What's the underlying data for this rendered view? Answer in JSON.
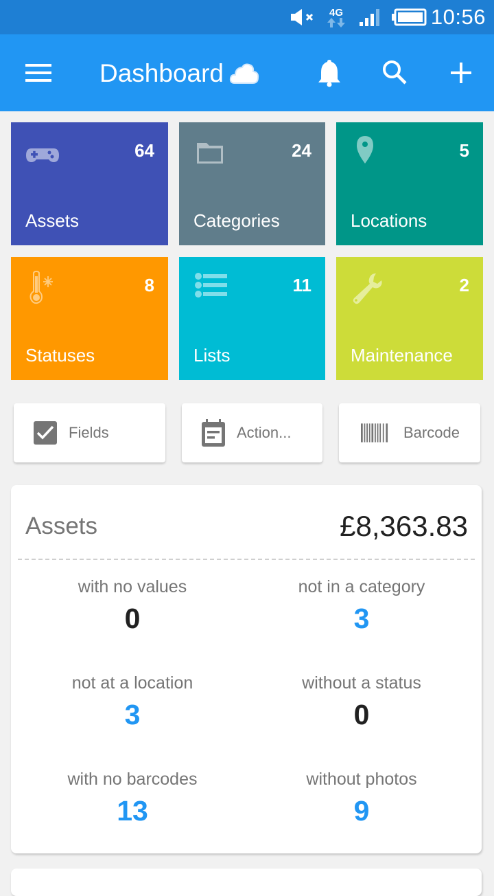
{
  "status_bar": {
    "time": "10:56",
    "network_label": "4G",
    "icons": [
      "volume-muted-icon",
      "4g-data-icon",
      "signal-icon",
      "battery-icon"
    ]
  },
  "app_bar": {
    "title": "Dashboard",
    "icons": [
      "menu-icon",
      "cloud-sync-icon",
      "notifications-bell-icon",
      "search-icon",
      "add-icon"
    ]
  },
  "tiles": [
    {
      "label": "Assets",
      "count": "64",
      "icon": "gamepad-icon",
      "color": "#3f51b5"
    },
    {
      "label": "Categories",
      "count": "24",
      "icon": "folder-icon",
      "color": "#607d8b"
    },
    {
      "label": "Locations",
      "count": "5",
      "icon": "location-pin-icon",
      "color": "#009688"
    },
    {
      "label": "Statuses",
      "count": "8",
      "icon": "thermometer-icon",
      "color": "#ff9800"
    },
    {
      "label": "Lists",
      "count": "11",
      "icon": "list-icon",
      "color": "#00bcd4"
    },
    {
      "label": "Maintenance",
      "count": "2",
      "icon": "wrench-icon",
      "color": "#cddc39"
    }
  ],
  "quick_actions": [
    {
      "label": "Fields",
      "icon": "checkbox-icon"
    },
    {
      "label": "Action...",
      "icon": "calendar-note-icon"
    },
    {
      "label": "Barcode",
      "icon": "barcode-icon"
    }
  ],
  "assets_summary": {
    "title": "Assets",
    "total_value": "£8,363.83",
    "stats": [
      {
        "label": "with no values",
        "value": "0"
      },
      {
        "label": "not in a category",
        "value": "3"
      },
      {
        "label": "not at a location",
        "value": "3"
      },
      {
        "label": "without a status",
        "value": "0"
      },
      {
        "label": "with no barcodes",
        "value": "13"
      },
      {
        "label": "without photos",
        "value": "9"
      }
    ]
  },
  "colors": {
    "primary": "#2196f3",
    "status_bar": "#1e7fd4",
    "highlight_value": "#2196f3"
  }
}
